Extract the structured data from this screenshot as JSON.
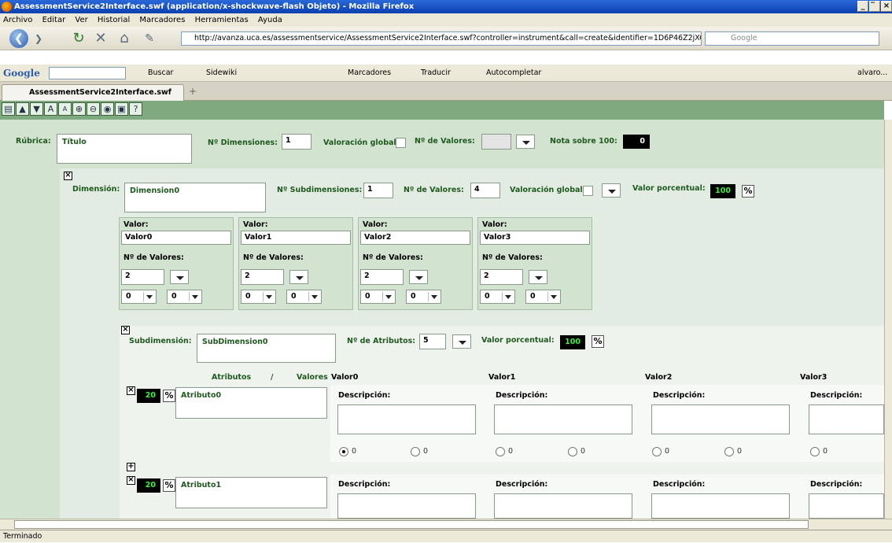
{
  "window": {
    "title": "AssessmentService2Interface.swf (application/x-shockwave-flash Objeto) - Mozilla Firefox",
    "buttons": [
      "_",
      "̅",
      "×"
    ]
  },
  "menu": [
    "Archivo",
    "Editar",
    "Ver",
    "Historial",
    "Marcadores",
    "Herramientas",
    "Ayuda"
  ],
  "nav": {
    "url": "http://avanza.uca.es/assessmentservice/AssessmentService2Interface.swf?controller=instrument&call=create&identifier=1D6P46Z2jXOaU2j",
    "search_placeholder": "Google"
  },
  "google_bar": {
    "logo": "Google",
    "items": [
      "Buscar",
      "Sidewiki",
      "Marcadores",
      "Traducir",
      "Autocompletar"
    ],
    "user": "alvaro..."
  },
  "tab": {
    "label": "AssessmentService2Interface.swf (...",
    "new_tab": "+"
  },
  "toolbar_icons": [
    "save-icon",
    "up-arrow-icon",
    "down-arrow-icon",
    "font-large-icon",
    "font-small-icon",
    "zoom-in-icon",
    "zoom-out-icon",
    "preview-icon",
    "print-icon",
    "help-icon"
  ],
  "rubric": {
    "label": "Rúbrica:",
    "title": "Título",
    "n_dims_label": "Nº Dimensiones:",
    "n_dims": "1",
    "global_label": "Valoración global",
    "n_vals_label": "Nº de Valores:",
    "n_vals": "",
    "grade_label": "Nota sobre 100:",
    "grade": "0"
  },
  "dimension": {
    "label": "Dimensión:",
    "name": "Dimension0",
    "n_sub_label": "Nº Subdimensiones:",
    "n_sub": "1",
    "n_vals_label": "Nº de Valores:",
    "n_vals": "4",
    "global_label": "Valoración global",
    "pct_label": "Valor porcentual:",
    "pct": "100",
    "pct_sign": "%",
    "values": [
      {
        "label": "Valor:",
        "name": "Valor0",
        "nv_label": "Nº de Valores:",
        "nv": "2",
        "a": "0",
        "b": "0"
      },
      {
        "label": "Valor:",
        "name": "Valor1",
        "nv_label": "Nº de Valores:",
        "nv": "2",
        "a": "0",
        "b": "0"
      },
      {
        "label": "Valor:",
        "name": "Valor2",
        "nv_label": "Nº de Valores:",
        "nv": "2",
        "a": "0",
        "b": "0"
      },
      {
        "label": "Valor:",
        "name": "Valor3",
        "nv_label": "Nº de Valores:",
        "nv": "2",
        "a": "0",
        "b": "0"
      }
    ]
  },
  "subdimension": {
    "label": "Subdimensión:",
    "name": "SubDimension0",
    "n_attr_label": "Nº de Atributos:",
    "n_attr": "5",
    "pct_label": "Valor porcentual:",
    "pct": "100",
    "pct_sign": "%",
    "col_attr": "Atributos",
    "col_sep": "/",
    "col_vals": "Valores",
    "value_headers": [
      "Valor0",
      "Valor1",
      "Valor2",
      "Valor3"
    ],
    "attributes": [
      {
        "weight": "20",
        "pct_sign": "%",
        "name": "Atributo0",
        "desc_label": "Descripción:",
        "radio_labels": [
          "0",
          "0",
          "0",
          "0",
          "0",
          "0",
          "0"
        ],
        "selected": 0
      },
      {
        "weight": "20",
        "pct_sign": "%",
        "name": "Atributo1",
        "desc_label": "Descripción:"
      }
    ]
  },
  "status": "Terminado",
  "colors": {
    "app_bg": "#d2e3cf",
    "label_green": "#1f5a1f",
    "toolbar_green": "#7fa97f"
  }
}
